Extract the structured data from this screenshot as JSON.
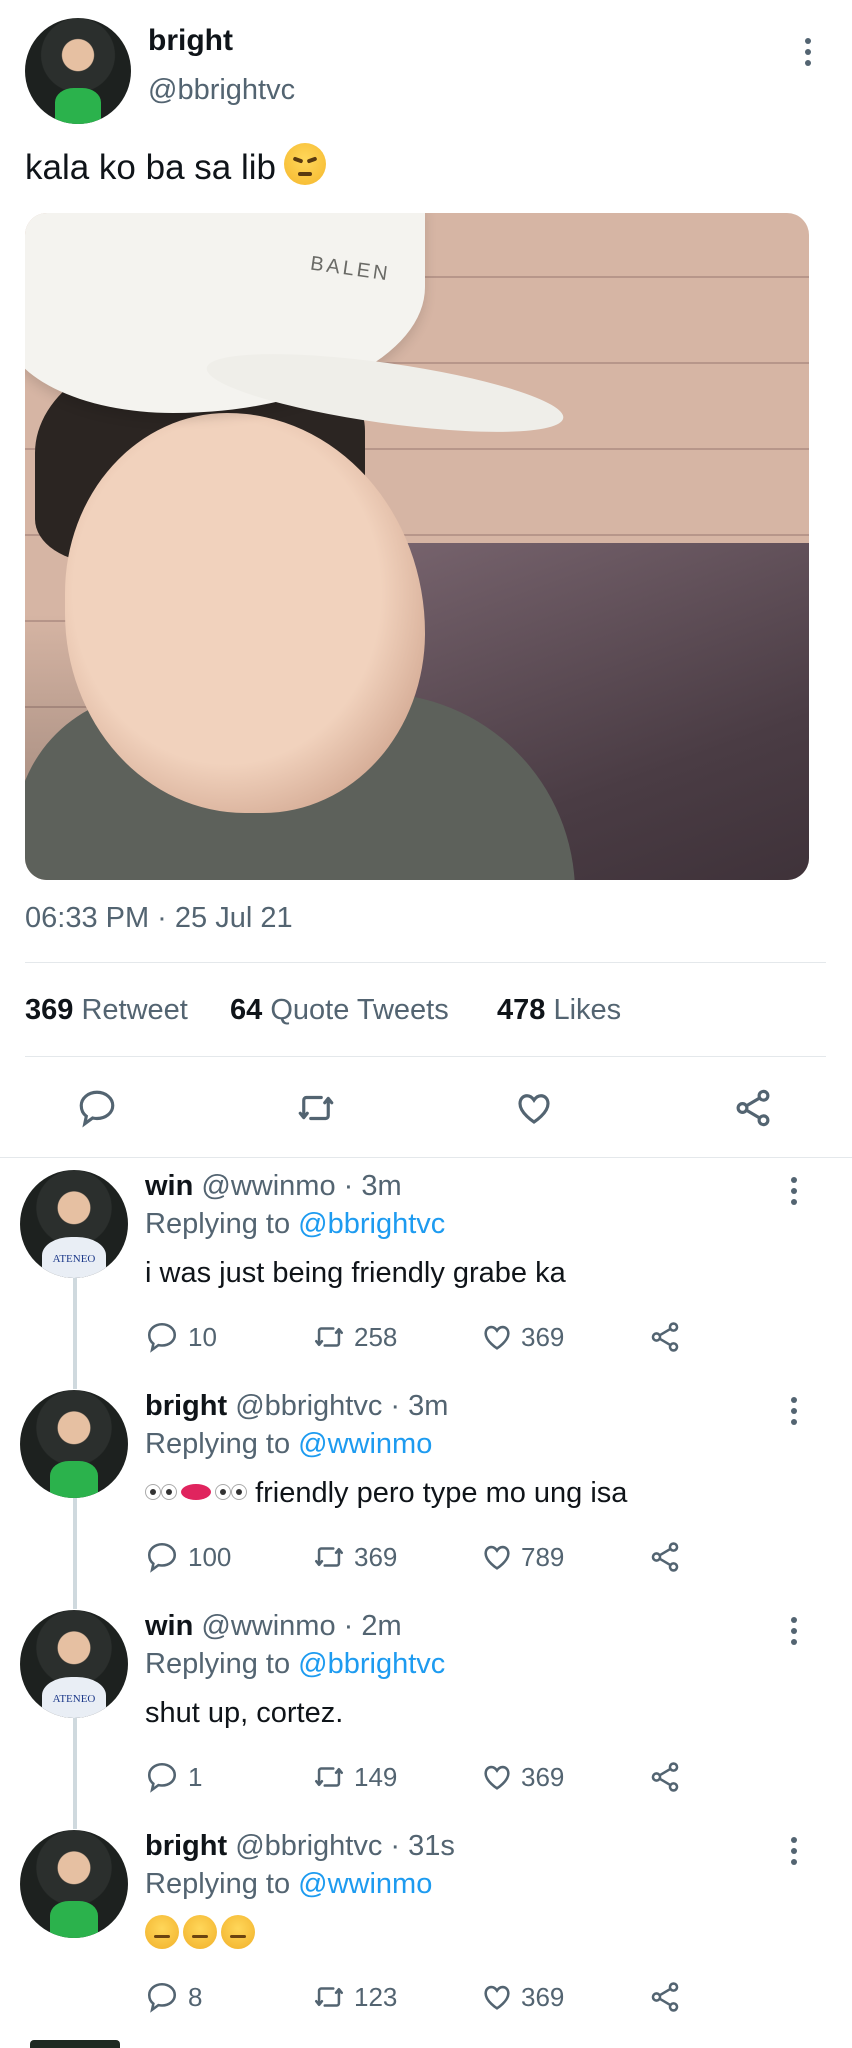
{
  "main_tweet": {
    "display_name": "bright",
    "handle": "@bbrightvc",
    "text": "kala ko ba sa lib",
    "photo_cap_text": "BALEN",
    "timestamp": "06:33 PM · 25 Jul 21",
    "stats": [
      {
        "count": "369",
        "label": "Retweet"
      },
      {
        "count": "64",
        "label": "Quote Tweets"
      },
      {
        "count": "478",
        "label": "Likes"
      }
    ]
  },
  "replies": [
    {
      "name": "win",
      "handle": "@wwinmo",
      "time": "· 3m",
      "replying_label": "Replying to",
      "replying_to": "@bbrightvc",
      "text": "i was just being friendly grabe ka",
      "jersey_text": "ATENEO",
      "replies": "10",
      "retweets": "258",
      "likes": "369"
    },
    {
      "name": "bright",
      "handle": "@bbrightvc",
      "time": "· 3m",
      "replying_label": "Replying to",
      "replying_to": "@wwinmo",
      "text": "friendly pero type mo ung isa",
      "replies": "100",
      "retweets": "369",
      "likes": "789"
    },
    {
      "name": "win",
      "handle": "@wwinmo",
      "time": "· 2m",
      "replying_label": "Replying to",
      "replying_to": "@bbrightvc",
      "text": "shut up, cortez.",
      "jersey_text": "ATENEO",
      "replies": "1",
      "retweets": "149",
      "likes": "369"
    },
    {
      "name": "bright",
      "handle": "@bbrightvc",
      "time": "· 31s",
      "replying_label": "Replying to",
      "replying_to": "@wwinmo",
      "text": "",
      "replies": "8",
      "retweets": "123",
      "likes": "369"
    }
  ],
  "icons": [
    "reply-icon",
    "retweet-icon",
    "like-icon",
    "share-icon",
    "more-icon"
  ]
}
